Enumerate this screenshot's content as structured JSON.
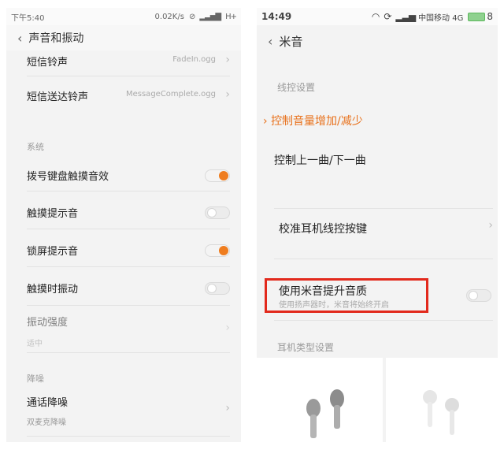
{
  "left": {
    "status": {
      "time": "下午5:40",
      "speed": "0.02K/s",
      "network": "H+"
    },
    "header": {
      "back": "‹",
      "title": "声音和振动"
    },
    "rows": {
      "sms_tone": {
        "label": "短信铃声",
        "value": "FadeIn.ogg"
      },
      "sms_sent_tone": {
        "label": "短信送达铃声",
        "value": "MessageComplete.ogg"
      },
      "section_system": "系统",
      "dialpad_tone": {
        "label": "拨号键盘触摸音效",
        "on": true
      },
      "touch_sound": {
        "label": "触摸提示音",
        "on": false
      },
      "lock_sound": {
        "label": "锁屏提示音",
        "on": true
      },
      "touch_vibrate": {
        "label": "触摸时振动",
        "on": false
      },
      "vibrate_strength": {
        "label": "振动强度",
        "value": "适中"
      },
      "section_noise": "降噪",
      "call_noise": {
        "label": "通话降噪",
        "value": "双麦克降噪"
      }
    }
  },
  "right": {
    "status": {
      "time": "14:49",
      "carrier": "中国移动 4G",
      "battery": "8"
    },
    "header": {
      "back": "‹",
      "title": "米音"
    },
    "section_wire": "线控设置",
    "vol_control": "控制音量增加/减少",
    "track_control": "控制上一曲/下一曲",
    "calibrate": "校准耳机线控按键",
    "enhance": {
      "title": "使用米音提升音质",
      "desc": "使用扬声器时，米音将始终开启"
    },
    "section_type": "耳机类型设置"
  },
  "colors": {
    "accent": "#ef7d1f",
    "highlight": "#e2291c",
    "background": "#f3f3f3"
  }
}
